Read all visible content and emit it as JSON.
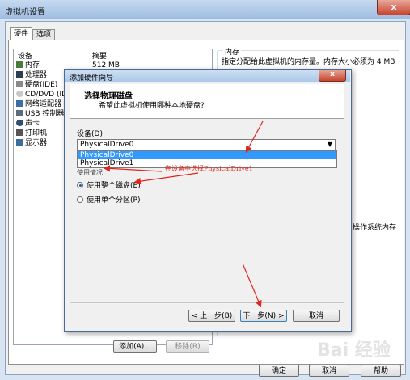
{
  "outer": {
    "title": "虚拟机设置",
    "close": "x",
    "tabs": [
      "硬件",
      "选项"
    ],
    "list_headers": {
      "device": "设备",
      "summary": "摘要"
    },
    "devices": [
      {
        "name": "内存",
        "summary": "512 MB",
        "icon": "memory-icon"
      },
      {
        "name": "处理器",
        "summary": "",
        "icon": "cpu-icon"
      },
      {
        "name": "硬盘(IDE)",
        "summary": "",
        "icon": "hard-disk-icon"
      },
      {
        "name": "CD/DVD (ID",
        "summary": "",
        "icon": "cd-dvd-icon"
      },
      {
        "name": "网络适配器",
        "summary": "",
        "icon": "network-icon"
      },
      {
        "name": "USB 控制器",
        "summary": "",
        "icon": "usb-icon"
      },
      {
        "name": "声卡",
        "summary": "",
        "icon": "sound-icon"
      },
      {
        "name": "打印机",
        "summary": "",
        "icon": "printer-icon"
      },
      {
        "name": "显示器",
        "summary": "",
        "icon": "display-icon"
      }
    ],
    "memory_group_label": "内存",
    "memory_hint": "指定分配给此虚拟机的内存量。内存大小必须为 4 MB",
    "os_memory_text": "操作系统内存",
    "add_button": "添加(A)...",
    "remove_button": "移除(R)",
    "ok_button": "确定",
    "cancel_button": "取消",
    "help_button": "帮助",
    "watermark": "Bai 经验"
  },
  "wizard": {
    "title": "添加硬件向导",
    "close": "x",
    "heading": "选择物理磁盘",
    "subheading": "希望此虚拟机使用哪种本地硬盘?",
    "device_label": "设备(D)",
    "selected_device": "PhysicalDrive0",
    "options": [
      "PhysicalDrive0",
      "PhysicalDrive1"
    ],
    "usage_label": "使用情况",
    "radio_whole": "使用整个磁盘(E)",
    "radio_partition": "使用单个分区(P)",
    "back_button": "< 上一步(B)",
    "next_button": "下一步(N) >",
    "cancel_button": "取消"
  },
  "annotation": "在设备中选择PhysicalDrive1",
  "colors": {
    "arrow": "#e0261b",
    "selection": "#3399ff"
  }
}
